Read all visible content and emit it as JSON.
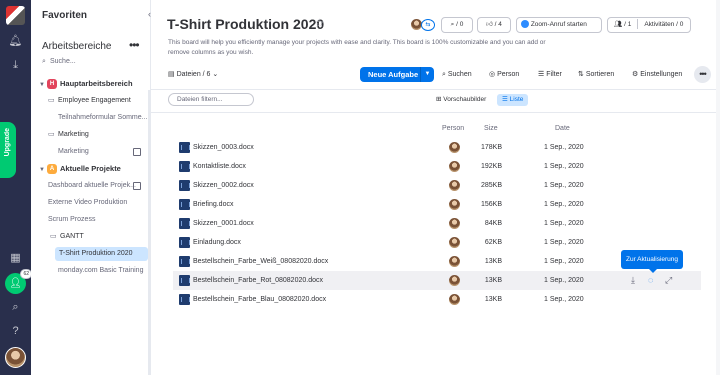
{
  "rail": {
    "upgrade_label": "Upgrade",
    "invite_badge": "62"
  },
  "panel": {
    "favorites_title": "Favoriten",
    "workspaces_title": "Arbeitsbereiche",
    "search_placeholder": "Suche...",
    "workspaces": [
      {
        "name": "Hauptarbeitsbereich",
        "badge": "H",
        "badge_color": "#e2445c",
        "items": [
          {
            "label": "Employee Engagement",
            "type": "folder"
          },
          {
            "label": "Teilnahmeformular Somme...",
            "type": "board"
          },
          {
            "label": "Marketing",
            "type": "folder"
          },
          {
            "label": "Marketing",
            "type": "board"
          }
        ]
      },
      {
        "name": "Aktuelle Projekte",
        "badge": "A",
        "badge_color": "#fdab3d",
        "items": [
          {
            "label": "Dashboard aktuelle Projek...",
            "type": "board"
          },
          {
            "label": "Externe Video Produktion",
            "type": "board"
          },
          {
            "label": "Scrum Prozess",
            "type": "board"
          },
          {
            "label": "GANTT",
            "type": "folder"
          },
          {
            "label": "T-Shirt Produktion 2020",
            "type": "board",
            "active": true
          },
          {
            "label": "monday.com Basic Training",
            "type": "board"
          }
        ]
      }
    ]
  },
  "header": {
    "title": "T-Shirt Produktion 2020",
    "description": "This board will help you efficiently manage your projects with ease and clarity. This board is 100% customizable and you can add or remove columns as you wish.",
    "zoom_label": "Zoom-Anruf starten",
    "activity_count": "0",
    "updates_count": "4",
    "members_count": "1",
    "activities_label": "Aktivitäten / 0"
  },
  "toolbar": {
    "files_label": "Dateien",
    "files_count": "/ 6",
    "new_task_label": "Neue Aufgabe",
    "search_label": "Suchen",
    "person_label": "Person",
    "filter_label": "Filter",
    "sort_label": "Sortieren",
    "settings_label": "Einstellungen"
  },
  "files_view": {
    "filter_placeholder": "Dateien filtern...",
    "view_preview": "Vorschaubilder",
    "view_list": "Liste",
    "columns": {
      "person": "Person",
      "size": "Size",
      "date": "Date"
    },
    "tooltip": "Zur Aktualisierung",
    "rows": [
      {
        "name": "Skizzen_0003.docx",
        "size": "178KB",
        "date": "1 Sep., 2020"
      },
      {
        "name": "Kontaktliste.docx",
        "size": "192KB",
        "date": "1 Sep., 2020"
      },
      {
        "name": "Skizzen_0002.docx",
        "size": "285KB",
        "date": "1 Sep., 2020"
      },
      {
        "name": "Briefing.docx",
        "size": "156KB",
        "date": "1 Sep., 2020"
      },
      {
        "name": "Skizzen_0001.docx",
        "size": "84KB",
        "date": "1 Sep., 2020"
      },
      {
        "name": "Einladung.docx",
        "size": "62KB",
        "date": "1 Sep., 2020"
      },
      {
        "name": "Bestellschein_Farbe_Weiß_08082020.docx",
        "size": "13KB",
        "date": "1 Sep., 2020"
      },
      {
        "name": "Bestellschein_Farbe_Rot_08082020.docx",
        "size": "13KB",
        "date": "1 Sep., 2020",
        "highlighted": true
      },
      {
        "name": "Bestellschein_Farbe_Blau_08082020.docx",
        "size": "13KB",
        "date": "1 Sep., 2020"
      }
    ]
  }
}
